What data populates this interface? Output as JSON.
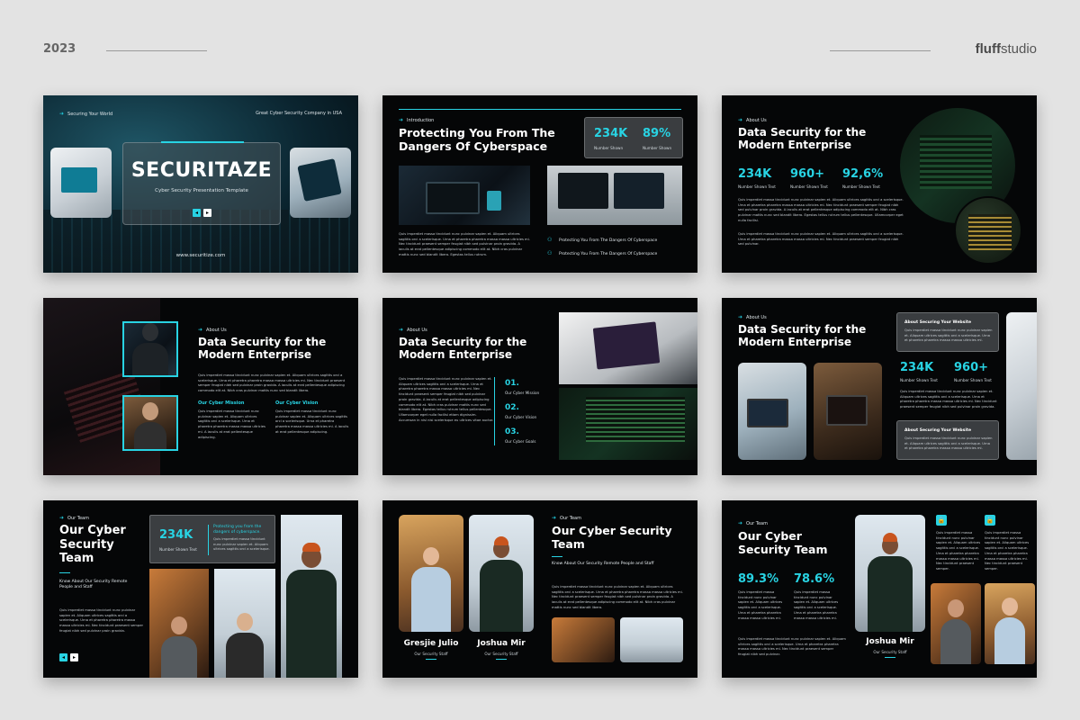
{
  "header": {
    "year": "2023",
    "brand_bold": "fluff",
    "brand_rest": "studio"
  },
  "slide1": {
    "kicker_left": "Securing Your World",
    "kicker_right": "Great Cyber Security Company in USA",
    "title": "SECURITAZE",
    "subtitle": "Cyber Security Presentation Template",
    "url": "www.securitize.com"
  },
  "slide2": {
    "kicker": "Introduction",
    "title": "Protecting You From The Dangers Of Cyberspace",
    "stats": [
      {
        "value": "234K",
        "label": "Number Shown"
      },
      {
        "value": "89%",
        "label": "Number Shown"
      }
    ],
    "para": "Quis imperdiet massa tincidunt nunc pulvinar sapien et. Aliquam ultrices sagittis orci a scelerisque. Urna et pharetra pharetra massa massa ultricies mi. Nec tincidunt praesent semper feugiat nibh sed pulvinar proin gravida. A iaculis at erat pellentesque adipiscing commodo elit at. Nibh cras pulvinar mattis nunc sed blandit libero. Egestas tellus rutrum.",
    "items": [
      "Protecting You From The Dangers Of Cyberspace",
      "Protecting You From The Dangers Of Cyberspace"
    ]
  },
  "slide3": {
    "kicker": "About Us",
    "title": "Data Security for the Modern Enterprise",
    "stats": [
      {
        "value": "234K",
        "label": "Number Shown Text"
      },
      {
        "value": "960+",
        "label": "Number Shown Text"
      },
      {
        "value": "92,6%",
        "label": "Number Shown Text"
      }
    ],
    "para1": "Quis imperdiet massa tincidunt nunc pulvinar sapien et. Aliquam ultrices sagittis orci a scelerisque. Urna et pharetra pharetra massa massa ultricies mi. Nec tincidunt praesent semper feugiat nibh sed pulvinar proin gravida. A iaculis at erat pellentesque adipiscing commodo elit at. Nibh cras pulvinar mattis nunc sed blandit libero. Egestas tellus rutrum tellus pellentesque. Ullamcorper eget nulla facilisi.",
    "para2": "Quis imperdiet massa tincidunt nunc pulvinar sapien et. Aliquam ultrices sagittis orci a scelerisque. Urna et pharetra pharetra massa massa ultricies mi. Nec tincidunt praesent semper feugiat nibh sed pulvinar."
  },
  "slide4": {
    "kicker": "About Us",
    "title": "Data Security for the Modern Enterprise",
    "para": "Quis imperdiet massa tincidunt nunc pulvinar sapien et. Aliquam ultrices sagittis orci a scelerisque. Urna et pharetra pharetra massa massa ultricies mi. Nec tincidunt praesent semper feugiat nibh sed pulvinar proin gravida. A iaculis at erat pellentesque adipiscing commodo elit at. Nibh cras pulvinar mattis nunc sed blandit libero.",
    "mission_title": "Our Cyber Mission",
    "mission_text": "Quis imperdiet massa tincidunt nunc pulvinar sapien et. Aliquam ultrices sagittis orci a scelerisque. Urna et pharetra pharetra massa massa ultricies mi. A iaculis at erat pellentesque adipiscing.",
    "vision_title": "Our Cyber Vision",
    "vision_text": "Quis imperdiet massa tincidunt nunc pulvinar sapien et. Aliquam ultrices sagittis orci a scelerisque. Urna et pharetra pharetra massa massa ultricies mi. A iaculis at erat pellentesque adipiscing."
  },
  "slide5": {
    "kicker": "About Us",
    "title": "Data Security for the Modern Enterprise",
    "para": "Quis imperdiet massa tincidunt nunc pulvinar sapien et. Aliquam ultrices sagittis orci a scelerisque. Urna et pharetra pharetra massa massa ultricies mi. Nec tincidunt praesent semper feugiat nibh sed pulvinar proin gravida. A iaculis at erat pellentesque adipiscing commodo elit at. Nibh cras pulvinar mattis nunc sed blandit libero. Egestas tellus rutrum tellus pellentesque. Ullamcorper eget nulla facilisi etiam dignissim. Accumsan in nisl nisi scelerisque eu ultrices vitae auctor.",
    "steps": [
      {
        "n": "01.",
        "label": "Our Cyber Mission"
      },
      {
        "n": "02.",
        "label": "Our Cyber Vision"
      },
      {
        "n": "03.",
        "label": "Our Cyber Goals"
      }
    ]
  },
  "slide6": {
    "kicker": "About Us",
    "title": "Data Security for the Modern Enterprise",
    "card1_title": "About Securing Your Website",
    "card1_text": "Quis imperdiet massa tincidunt nunc pulvinar sapien et. Aliquam ultrices sagittis orci a scelerisque. Urna et pharetra pharetra massa massa ultricies mi.",
    "stats": [
      {
        "value": "234K",
        "label": "Number Shown Text"
      },
      {
        "value": "960+",
        "label": "Number Shown Text"
      }
    ],
    "para": "Quis imperdiet massa tincidunt nunc pulvinar sapien et. Aliquam ultrices sagittis orci a scelerisque. Urna et pharetra pharetra massa massa ultricies mi. Nec tincidunt praesent semper feugiat nibh sed pulvinar proin gravida.",
    "card2_title": "About Securing Your Website",
    "card2_text": "Quis imperdiet massa tincidunt nunc pulvinar sapien et. Aliquam ultrices sagittis orci a scelerisque. Urna et pharetra pharetra massa massa ultricies mi."
  },
  "slide7": {
    "kicker": "Our Team",
    "title": "Our Cyber Security Team",
    "subtitle": "Know About Our Security Remote People and Staff",
    "stat_value": "234K",
    "stat_label": "Number Shown Text",
    "quote_title": "Protecting you from the dangers of cyberspace.",
    "quote_text": "Quis imperdiet massa tincidunt nunc pulvinar sapien et. Aliquam ultrices sagittis orci a scelerisque.",
    "para": "Quis imperdiet massa tincidunt nunc pulvinar sapien et. Aliquam ultrices sagittis orci a scelerisque. Urna et pharetra pharetra massa massa ultricies mi. Nec tincidunt praesent semper feugiat nibh sed pulvinar proin gravida."
  },
  "slide8": {
    "kicker": "Our Team",
    "title": "Our Cyber Security Team",
    "subtitle": "Know About Our Security Remote People and Staff",
    "para": "Quis imperdiet massa tincidunt nunc pulvinar sapien et. Aliquam ultrices sagittis orci a scelerisque. Urna et pharetra pharetra massa massa ultricies mi. Nec tincidunt praesent semper feugiat nibh sed pulvinar proin gravida. A iaculis at erat pellentesque adipiscing commodo elit at. Nibh cras pulvinar mattis nunc sed blandit libero.",
    "members": [
      {
        "name": "Gresjie Julio",
        "role": "Our Security Staff"
      },
      {
        "name": "Joshua Mir",
        "role": "Our Security Staff"
      }
    ]
  },
  "slide9": {
    "kicker": "Our Team",
    "title": "Our Cyber Security Team",
    "stats": [
      {
        "value": "89.3%"
      },
      {
        "value": "78.6%"
      }
    ],
    "stat_text": "Quis imperdiet massa tincidunt nunc pulvinar sapien et. Aliquam ultrices sagittis orci a scelerisque. Urna et pharetra pharetra massa massa ultricies mi.",
    "para": "Quis imperdiet massa tincidunt nunc pulvinar sapien et. Aliquam ultrices sagittis orci a scelerisque. Urna et pharetra pharetra massa massa ultricies mi. Nec tincidunt praesent semper feugiat nibh sed pulvinar.",
    "member": {
      "name": "Joshua Mir",
      "role": "Our Security Staff"
    },
    "lock_text": "Quis imperdiet massa tincidunt nunc pulvinar sapien et. Aliquam ultrices sagittis orci a scelerisque. Urna et pharetra pharetra massa massa ultricies mi. Nec tincidunt praesent semper."
  },
  "colors": {
    "accent": "#28d3e3",
    "slide_bg": "#050607",
    "page_bg": "#e3e3e3"
  }
}
